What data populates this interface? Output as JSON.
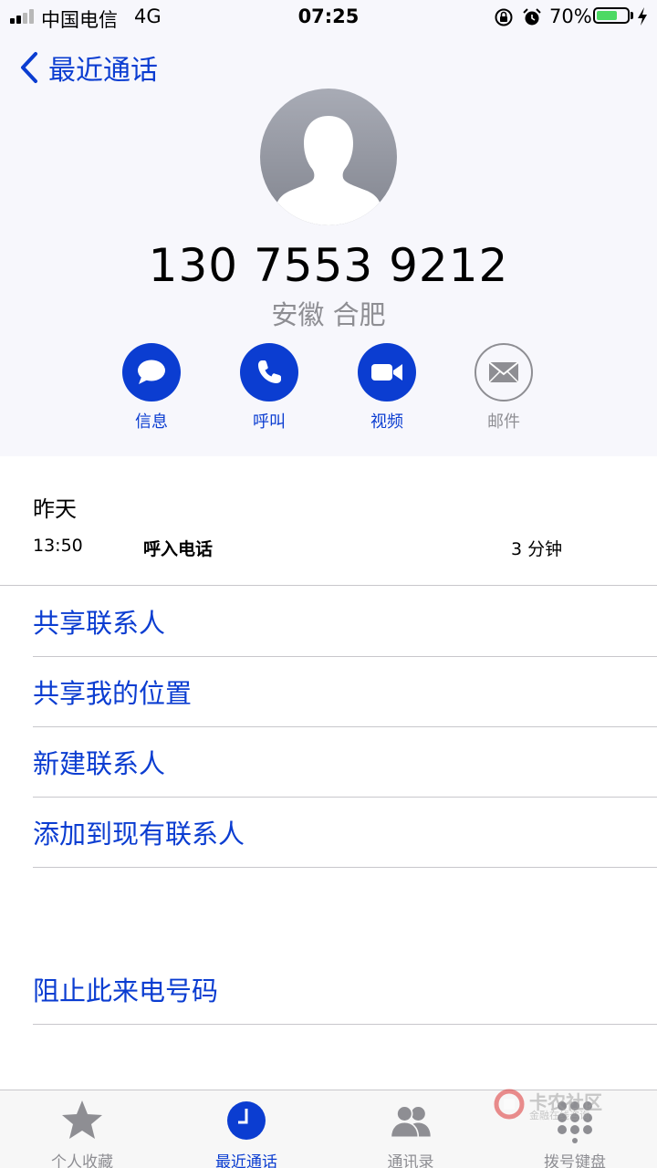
{
  "status_bar": {
    "carrier": "中国电信",
    "network": "4G",
    "time": "07:25",
    "battery_percent": "70%",
    "battery_level": 0.7
  },
  "nav": {
    "back_label": "最近通话"
  },
  "contact": {
    "phone_number": "130 7553 9212",
    "location": "安徽 合肥"
  },
  "actions": [
    {
      "label": "信息",
      "icon": "message-icon"
    },
    {
      "label": "呼叫",
      "icon": "phone-icon"
    },
    {
      "label": "视频",
      "icon": "video-icon"
    },
    {
      "label": "邮件",
      "icon": "mail-icon"
    }
  ],
  "call_log": {
    "date": "昨天",
    "time": "13:50",
    "type": "呼入电话",
    "duration": "3 分钟"
  },
  "options": [
    "共享联系人",
    "共享我的位置",
    "新建联系人",
    "添加到现有联系人"
  ],
  "block_label": "阻止此来电号码",
  "tabs": [
    {
      "label": "个人收藏",
      "icon": "star-icon",
      "active": false
    },
    {
      "label": "最近通话",
      "icon": "clock-icon",
      "active": true
    },
    {
      "label": "通讯录",
      "icon": "contacts-icon",
      "active": false
    },
    {
      "label": "拨号键盘",
      "icon": "keypad-icon",
      "active": false
    }
  ],
  "watermark": {
    "title": "卡农社区",
    "subtitle": "金融在线咨询"
  },
  "colors": {
    "accent": "#0b3dd1",
    "gray": "#8e8e93",
    "battery": "#4cd964",
    "header_bg": "#f7f7fc"
  }
}
